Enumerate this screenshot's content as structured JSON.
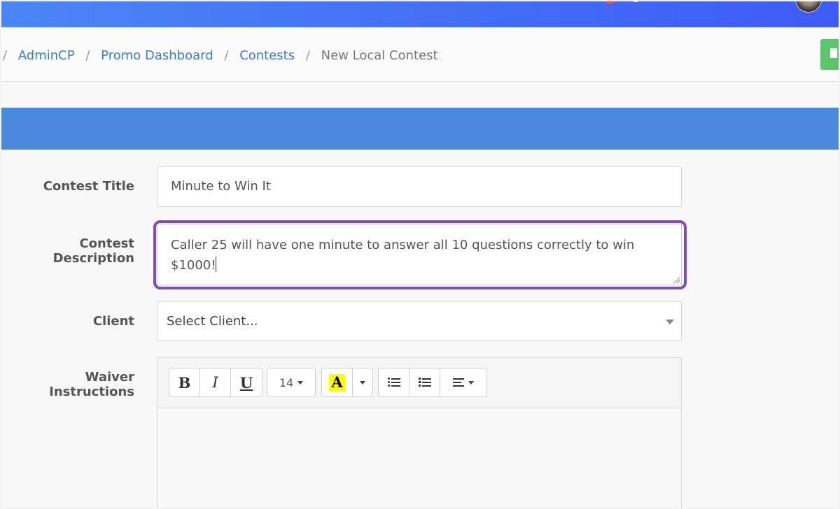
{
  "breadcrumb": {
    "items": [
      "AdminCP",
      "Promo Dashboard",
      "Contests"
    ],
    "current": "New Local Contest",
    "separator": "/"
  },
  "form": {
    "title_label": "Contest Title",
    "title_value": "Minute to Win It",
    "description_label": "Contest Description",
    "description_value": "Caller 25 will have one minute to answer all 10 questions correctly to win $1000!",
    "client_label": "Client",
    "client_value": "Select Client...",
    "waiver_label": "Waiver Instructions"
  },
  "editor": {
    "bold_label": "B",
    "italic_label": "I",
    "underline_label": "U",
    "font_size": "14",
    "color_label": "A",
    "highlight_color": "#ffff00"
  },
  "colors": {
    "topbar": "#4a86f5",
    "panel_header": "#4a89dc",
    "focus_ring": "#7b4dbf",
    "link": "#3a7bd5",
    "action_button": "#5cc46b"
  },
  "icons": [
    "notification-dot-icon",
    "user-avatar",
    "bullet-list-icon",
    "numbered-list-icon",
    "align-left-icon",
    "chevron-down-icon"
  ]
}
